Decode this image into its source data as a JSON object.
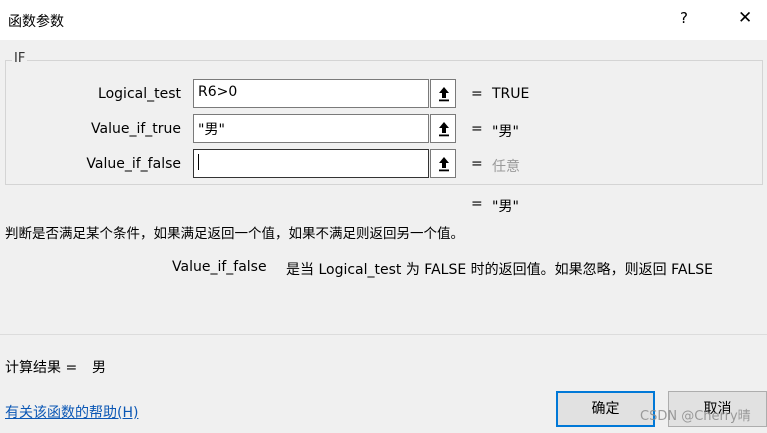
{
  "window": {
    "title": "函数参数",
    "help_label": "?",
    "close_label": "✕"
  },
  "group": {
    "label": "IF"
  },
  "args": [
    {
      "label": "Logical_test",
      "value": "R6>0",
      "result": "TRUE"
    },
    {
      "label": "Value_if_true",
      "value": "\"男\"",
      "result": "\"男\""
    },
    {
      "label": "Value_if_false",
      "value": "",
      "result": "任意"
    }
  ],
  "equals": "=",
  "formula_result": "\"男\"",
  "description": "判断是否满足某个条件，如果满足返回一个值，如果不满足则返回另一个值。",
  "param_help": {
    "name": "Value_if_false",
    "text": "是当 Logical_test 为 FALSE 时的返回值。如果忽略，则返回 FALSE"
  },
  "calc": {
    "label": "计算结果 =",
    "value": "男"
  },
  "help_link": "有关该函数的帮助(H)",
  "buttons": {
    "ok": "确定",
    "cancel": "取消"
  },
  "watermark": "CSDN @Cherry晴",
  "icons": {
    "ref_button": "collapse-dialog-icon"
  }
}
